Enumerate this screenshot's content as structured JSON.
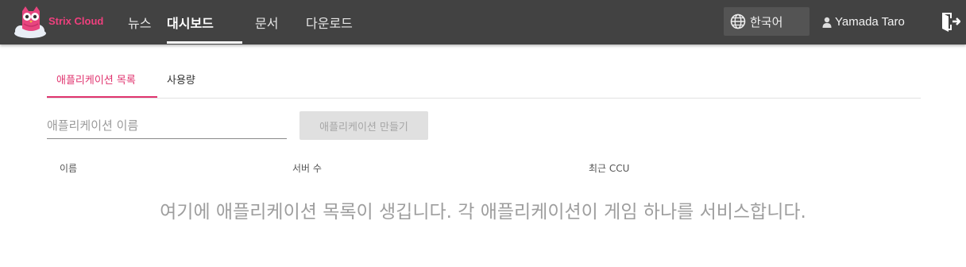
{
  "header": {
    "brand": "Strix Cloud",
    "nav": [
      {
        "label": "뉴스",
        "active": false
      },
      {
        "label": "대시보드",
        "active": true
      },
      {
        "label": "문서",
        "active": false
      },
      {
        "label": "다운로드",
        "active": false
      }
    ],
    "language": {
      "label": "한국어",
      "icon": "globe-icon"
    },
    "user": {
      "name": "Yamada Taro",
      "icon": "person-icon"
    },
    "logout_icon": "logout-icon",
    "colors": {
      "bar": "#424242",
      "brand": "#f0407e"
    }
  },
  "tabs": [
    {
      "label": "애플리케이션 목록",
      "active": true
    },
    {
      "label": "사용량",
      "active": false
    }
  ],
  "form": {
    "name_placeholder": "애플리케이션 이름",
    "create_label": "애플리케이션 만들기"
  },
  "table": {
    "columns": [
      "이름",
      "서버 수",
      "최근 CCU"
    ]
  },
  "empty_message": "여기에 애플리케이션 목록이 생깁니다. 각 애플리케이션이 게임 하나를 서비스합니다.",
  "accent": "#e0346f"
}
